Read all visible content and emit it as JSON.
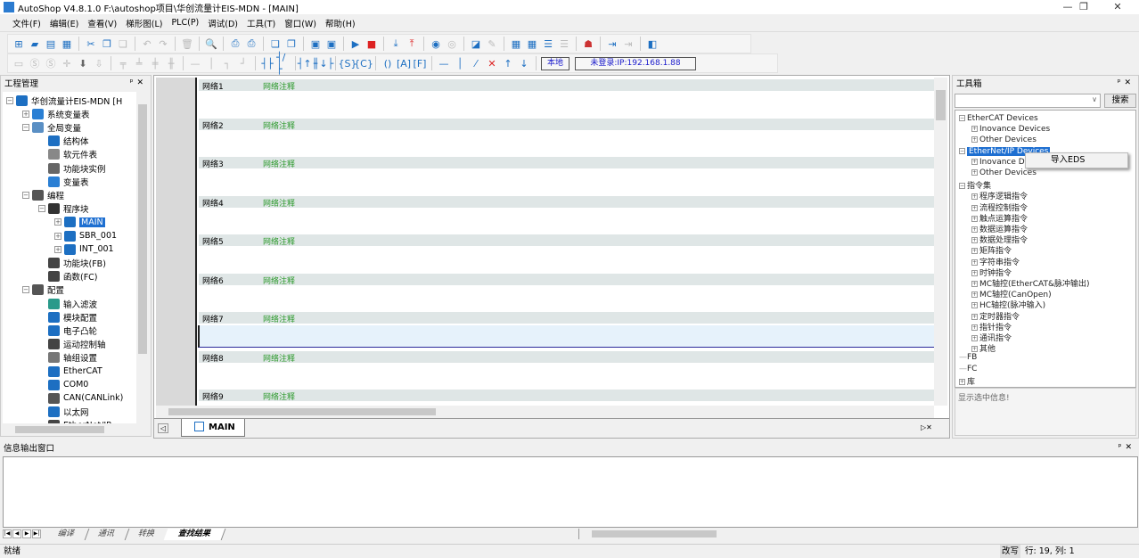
{
  "window": {
    "title": "AutoShop V4.8.1.0  F:\\autoshop项目\\华创流量计EIS-MDN - [MAIN]",
    "minimize": "—",
    "maximize": "❐",
    "close": "✕"
  },
  "menu": [
    "文件(F)",
    "编辑(E)",
    "查看(V)",
    "梯形图(L)",
    "PLC(P)",
    "调试(D)",
    "工具(T)",
    "窗口(W)",
    "帮助(H)"
  ],
  "toolbar2": {
    "local_label": "本地",
    "login_status": "未登录:IP:192.168.1.88"
  },
  "project_panel": {
    "title": "工程管理",
    "items": [
      {
        "label": "华创流量计EIS-MDN [H"
      },
      {
        "label": "系统变量表"
      },
      {
        "label": "全局变量"
      },
      {
        "label": "结构体"
      },
      {
        "label": "软元件表"
      },
      {
        "label": "功能块实例"
      },
      {
        "label": "变量表"
      },
      {
        "label": "编程"
      },
      {
        "label": "程序块"
      },
      {
        "label": "MAIN"
      },
      {
        "label": "SBR_001"
      },
      {
        "label": "INT_001"
      },
      {
        "label": "功能块(FB)"
      },
      {
        "label": "函数(FC)"
      },
      {
        "label": "配置"
      },
      {
        "label": "输入滤波"
      },
      {
        "label": "模块配置"
      },
      {
        "label": "电子凸轮"
      },
      {
        "label": "运动控制轴"
      },
      {
        "label": "轴组设置"
      },
      {
        "label": "EtherCAT"
      },
      {
        "label": "COM0"
      },
      {
        "label": "CAN(CANLink)"
      },
      {
        "label": "以太网"
      },
      {
        "label": "EtherNet/IP"
      }
    ]
  },
  "editor": {
    "networks": [
      {
        "label": "网络1",
        "comment": "网络注释"
      },
      {
        "label": "网络2",
        "comment": "网络注释"
      },
      {
        "label": "网络3",
        "comment": "网络注释"
      },
      {
        "label": "网络4",
        "comment": "网络注释"
      },
      {
        "label": "网络5",
        "comment": "网络注释"
      },
      {
        "label": "网络6",
        "comment": "网络注释"
      },
      {
        "label": "网络7",
        "comment": "网络注释"
      },
      {
        "label": "网络8",
        "comment": "网络注释"
      },
      {
        "label": "网络9",
        "comment": "网络注释"
      }
    ],
    "tab": "MAIN"
  },
  "toolbox": {
    "title": "工具箱",
    "search_value": "",
    "search_button": "搜索",
    "items": [
      {
        "label": "EtherCAT Devices"
      },
      {
        "label": "Inovance Devices"
      },
      {
        "label": "Other Devices"
      },
      {
        "label": "EtherNet/IP Devices"
      },
      {
        "label": "Inovance Devices"
      },
      {
        "label": "Other Devices"
      },
      {
        "label": "指令集"
      },
      {
        "label": "程序逻辑指令"
      },
      {
        "label": "流程控制指令"
      },
      {
        "label": "触点运算指令"
      },
      {
        "label": "数据运算指令"
      },
      {
        "label": "数据处理指令"
      },
      {
        "label": "矩阵指令"
      },
      {
        "label": "字符串指令"
      },
      {
        "label": "时钟指令"
      },
      {
        "label": "MC轴控(EtherCAT&脉冲输出)"
      },
      {
        "label": "MC轴控(CanOpen)"
      },
      {
        "label": "HC轴控(脉冲输入)"
      },
      {
        "label": "定时器指令"
      },
      {
        "label": "指针指令"
      },
      {
        "label": "通讯指令"
      },
      {
        "label": "其他"
      },
      {
        "label": "FB"
      },
      {
        "label": "FC"
      },
      {
        "label": "库"
      }
    ],
    "context_menu": "导入EDS",
    "info": "显示选中信息!"
  },
  "output": {
    "title": "信息输出窗口",
    "tabs": [
      "编译",
      "通讯",
      "转换",
      "查找结果"
    ]
  },
  "status": {
    "left": "就绪",
    "mode": "改写",
    "position": "行:  19, 列:  1"
  }
}
